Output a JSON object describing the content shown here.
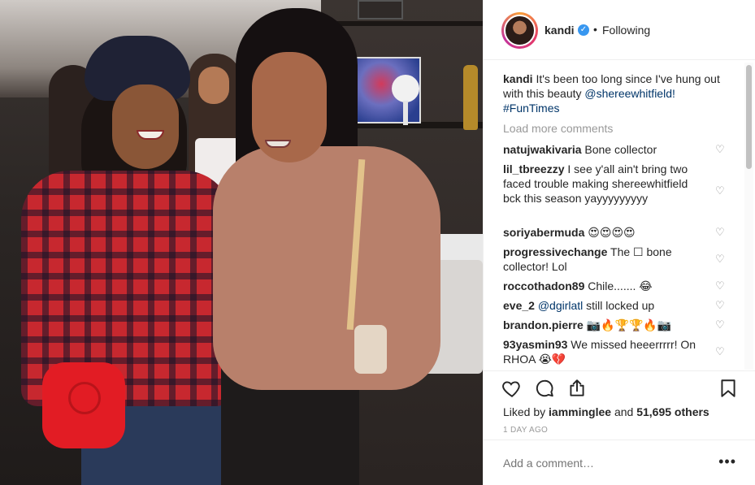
{
  "header": {
    "username": "kandi",
    "verified_mark": "✓",
    "separator": "•",
    "follow_status": "Following"
  },
  "caption": {
    "username": "kandi",
    "text_before": "It's been too long since I've hung out with this beauty",
    "mention": "@shereewhitfield!",
    "hashtag": "#FunTimes"
  },
  "load_more": "Load more comments",
  "comments": [
    {
      "user": "natujwakivaria",
      "text": "Bone collector"
    },
    {
      "user": "lil_tbreezzy",
      "text": "I see y'all ain't bring two faced trouble making shereewhitfield bck this season yayyyyyyyyy"
    },
    {
      "user": "soriyabermuda",
      "text": "😍😍😍😍"
    },
    {
      "user": "progressivechange",
      "text": "The ☐ bone collector! Lol"
    },
    {
      "user": "roccothadon89",
      "text": "Chile....... 😂"
    },
    {
      "user": "eve_2",
      "mention": "@dgirlatl",
      "text": "still locked up"
    },
    {
      "user": "brandon.pierre",
      "text": "📷🔥🏆🏆🔥📷"
    },
    {
      "user": "93yasmin93",
      "text": "We missed heeerrrrr! On RHOA 😭💔"
    }
  ],
  "actions": {
    "like_icon": "heart-icon",
    "comment_icon": "comment-icon",
    "share_icon": "share-icon",
    "save_icon": "bookmark-icon"
  },
  "likes": {
    "prefix": "Liked by",
    "user": "iamminglee",
    "middle": "and",
    "count": "51,695 others"
  },
  "timestamp": "1 DAY AGO",
  "add_comment": {
    "placeholder": "Add a comment…",
    "more": "•••"
  },
  "colors": {
    "link": "#003569",
    "verified": "#3897f0",
    "muted": "#999999",
    "text": "#262626"
  }
}
